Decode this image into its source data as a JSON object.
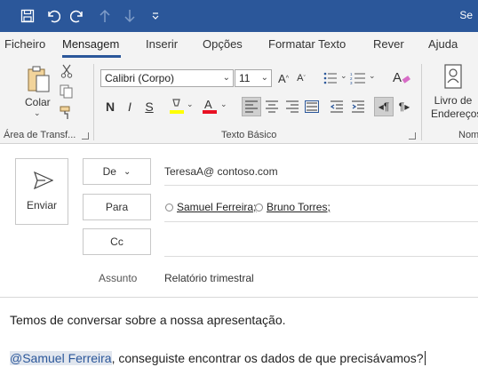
{
  "titlebar": {
    "title_partial": "Se"
  },
  "tabs": [
    {
      "label": "Ficheiro"
    },
    {
      "label": "Mensagem"
    },
    {
      "label": "Inserir"
    },
    {
      "label": "Opções"
    },
    {
      "label": "Formatar Texto"
    },
    {
      "label": "Rever"
    },
    {
      "label": "Ajuda"
    }
  ],
  "active_tab": "Mensagem",
  "ribbon": {
    "clipboard": {
      "paste_label": "Colar",
      "group_label": "Área de Transf..."
    },
    "basic_text": {
      "font_name": "Calibri (Corpo)",
      "font_size": "11",
      "group_label": "Texto Básico",
      "bold": "N",
      "italic": "I",
      "underline": "S"
    },
    "names": {
      "address_book_label": "Livro de Endereços",
      "group_label_partial": "Nom"
    }
  },
  "compose": {
    "send_label": "Enviar",
    "from_label": "De",
    "from_value": "TeresaA@ contoso.com",
    "to_label": "Para",
    "to_recipients": [
      "Samuel Ferreira;",
      "Bruno Torres;"
    ],
    "cc_label": "Cc",
    "subject_label": "Assunto",
    "subject_value": "Relatório trimestral"
  },
  "body": {
    "line1": "Temos de conversar sobre a nossa apresentação.",
    "mention": "@Samuel Ferreira",
    "line2_rest": ", conseguiste encontrar os dados de que precisávamos?"
  },
  "colors": {
    "titlebar": "#2b579a",
    "highlight": "#ffff00",
    "font_color": "#e81123",
    "mention_text": "#2b579a"
  }
}
